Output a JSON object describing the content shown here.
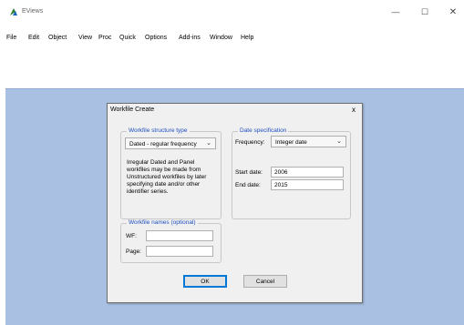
{
  "window": {
    "title": "EViews",
    "controls": {
      "minimize": "—",
      "maximize": "☐",
      "close": "✕"
    }
  },
  "menu": [
    "File",
    "Edit",
    "Object",
    "View",
    "Proc",
    "Quick",
    "Options",
    "Add-ins",
    "Window",
    "Help"
  ],
  "dialog": {
    "title": "Workfile Create",
    "close": "x",
    "structure": {
      "label": "Workfile structure type",
      "selected": "Dated - regular frequency",
      "note": "Irregular Dated and Panel workfiles may be made from Unstructured workfiles by later specifying date and/or other identifier series."
    },
    "date_spec": {
      "label": "Date specification",
      "frequency_label": "Frequency:",
      "frequency_value": "Integer date",
      "start_label": "Start date:",
      "start_value": "2006",
      "end_label": "End date:",
      "end_value": "2015"
    },
    "names": {
      "label": "Workfile names (optional)",
      "wf_label": "WF:",
      "wf_value": "",
      "page_label": "Page:",
      "page_value": ""
    },
    "buttons": {
      "ok": "OK",
      "cancel": "Cancel"
    }
  }
}
